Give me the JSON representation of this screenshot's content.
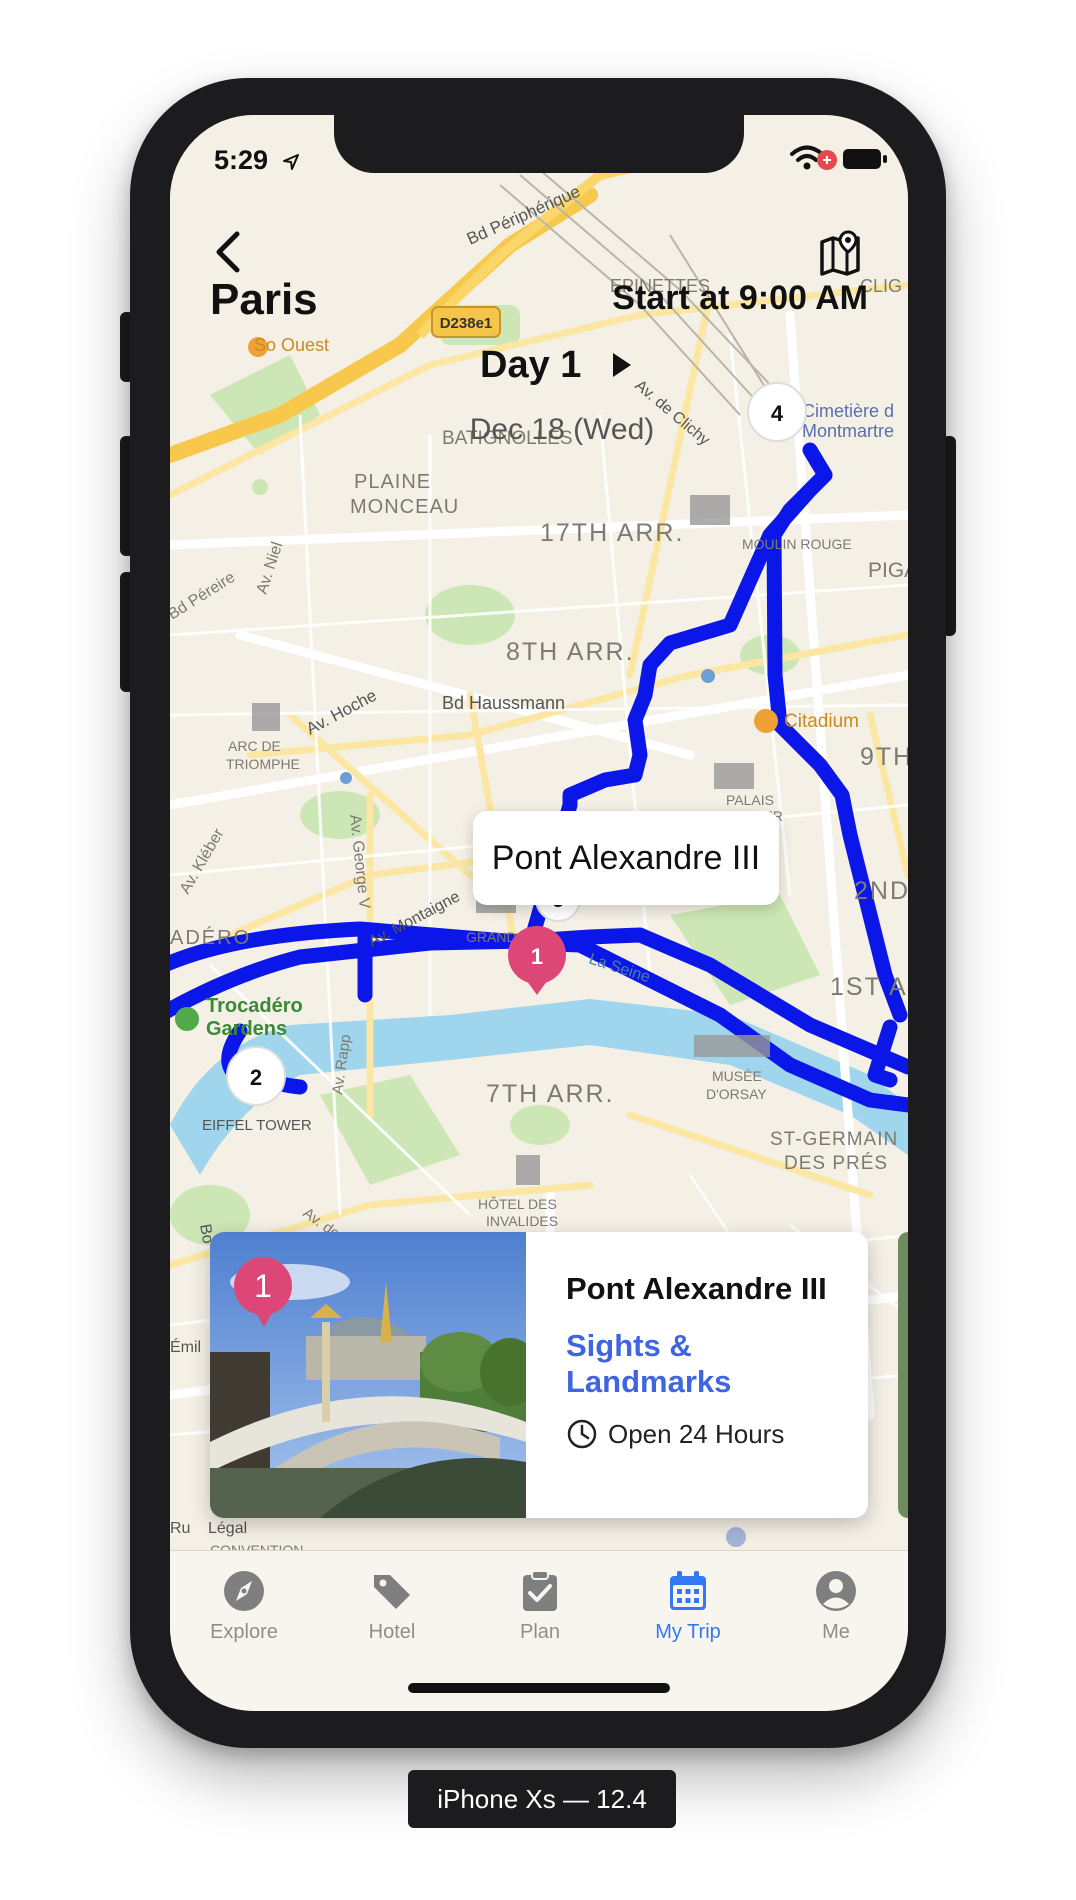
{
  "status": {
    "time": "5:29"
  },
  "header": {
    "city": "Paris",
    "start_time": "Start at 9:00 AM",
    "day_title": "Day 1",
    "date": "Dec 18 (Wed)"
  },
  "map": {
    "route_color": "#0b17e8",
    "markers": [
      {
        "label": "1",
        "color": "#dd4777"
      },
      {
        "label": "2"
      },
      {
        "label": "3"
      },
      {
        "label": "4"
      }
    ],
    "place_labels": [
      "So Ouest",
      "Bd Périphérique",
      "D238e1",
      "EPINETTES",
      "CLIG",
      "BATIGNOLLES",
      "Cimetière d",
      "Montmartre",
      "PLAINE",
      "MONCEAU",
      "17TH ARR.",
      "MOULIN ROUGE",
      "PIGAL",
      "Bd Péreire",
      "Av. Niel",
      "8TH ARR.",
      "Bd Haussmann",
      "Av. Hoche",
      "Citadium",
      "ARC DE",
      "TRIOMPHE",
      "9TH",
      "PALAIS",
      "ARNIER",
      "Av. Kléber",
      "Av. George V",
      "Av. Montaigne",
      "2ND",
      "ADÉRO",
      "GRAND",
      "La Seine",
      "1ST A",
      "Trocadéro",
      "Gardens",
      "EIFFEL TOWER",
      "Av. Rapp",
      "7TH ARR.",
      "MUSÉE",
      "D'ORSAY",
      "ST-GERMAIN",
      "DES PRÉS",
      "HÔTEL DES",
      "INVALIDES",
      "Av. de",
      "Av. de Clichy",
      "Bo",
      "Émil",
      "Légal",
      "CONVENTION",
      "Ru"
    ],
    "callout": "Pont Alexandre III"
  },
  "card": {
    "badge": "1",
    "name": "Pont Alexandre III",
    "category": "Sights & Landmarks",
    "hours": "Open 24 Hours"
  },
  "tabs": [
    {
      "label": "Explore",
      "icon": "compass-icon"
    },
    {
      "label": "Hotel",
      "icon": "tag-icon"
    },
    {
      "label": "Plan",
      "icon": "checklist-icon"
    },
    {
      "label": "My Trip",
      "icon": "calendar-icon",
      "active": true
    },
    {
      "label": "Me",
      "icon": "person-icon"
    }
  ],
  "colors": {
    "accent": "#3478f6",
    "category": "#3f66e0",
    "marker": "#dd4777"
  },
  "simulator": {
    "label": "iPhone Xs — 12.4"
  }
}
